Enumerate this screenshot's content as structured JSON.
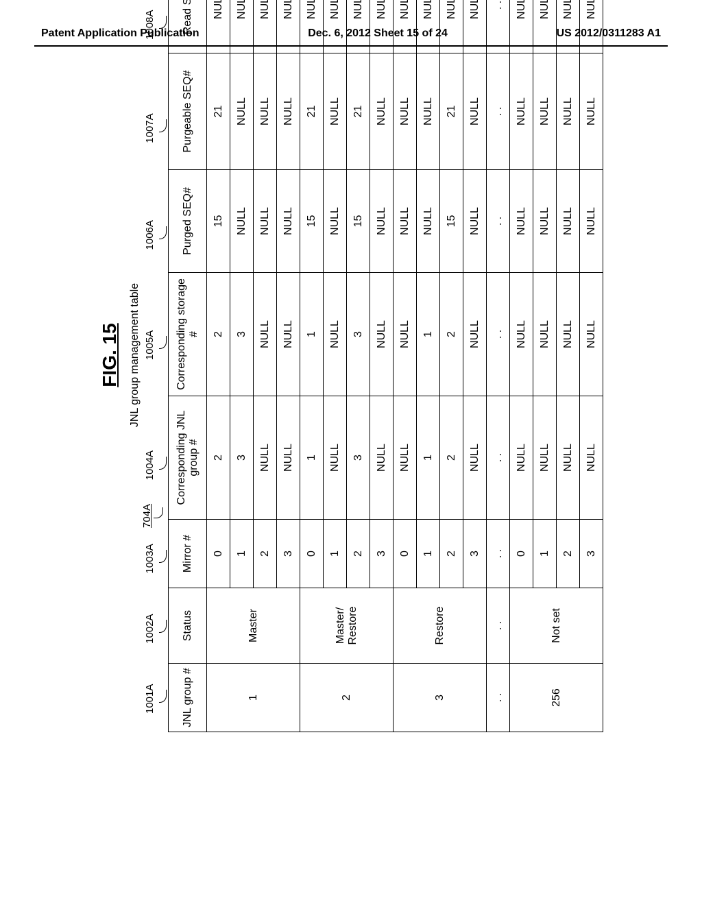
{
  "header": {
    "left": "Patent Application Publication",
    "center": "Dec. 6, 2012  Sheet 15 of 24",
    "right": "US 2012/0311283 A1"
  },
  "figure": {
    "title": "FIG. 15",
    "caption": "JNL group management table",
    "main_ref": "704A",
    "col_refs": [
      "1001A",
      "1002A",
      "1003A",
      "1004A",
      "1005A",
      "1006A",
      "1007A",
      "1008A"
    ],
    "headers": [
      "JNL group #",
      "Status",
      "Mirror #",
      "Corresponding JNL group #",
      "Corresponding storage #",
      "Purged SEQ#",
      "Purgeable SEQ#",
      "Read SEQ#"
    ],
    "groups": [
      {
        "jnl": "1",
        "status": "Master",
        "rows": [
          {
            "mirror": "0",
            "cjnl": "2",
            "cstg": "2",
            "purged": "15",
            "purgeable": "21",
            "read": "NULL"
          },
          {
            "mirror": "1",
            "cjnl": "3",
            "cstg": "3",
            "purged": "NULL",
            "purgeable": "NULL",
            "read": "NULL"
          },
          {
            "mirror": "2",
            "cjnl": "NULL",
            "cstg": "NULL",
            "purged": "NULL",
            "purgeable": "NULL",
            "read": "NULL"
          },
          {
            "mirror": "3",
            "cjnl": "NULL",
            "cstg": "NULL",
            "purged": "NULL",
            "purgeable": "NULL",
            "read": "NULL"
          }
        ]
      },
      {
        "jnl": "2",
        "status": "Master/ Restore",
        "rows": [
          {
            "mirror": "0",
            "cjnl": "1",
            "cstg": "1",
            "purged": "15",
            "purgeable": "21",
            "read": "NULL"
          },
          {
            "mirror": "1",
            "cjnl": "NULL",
            "cstg": "NULL",
            "purged": "NULL",
            "purgeable": "NULL",
            "read": "NULL"
          },
          {
            "mirror": "2",
            "cjnl": "3",
            "cstg": "3",
            "purged": "15",
            "purgeable": "21",
            "read": "NULL"
          },
          {
            "mirror": "3",
            "cjnl": "NULL",
            "cstg": "NULL",
            "purged": "NULL",
            "purgeable": "NULL",
            "read": "NULL"
          }
        ]
      },
      {
        "jnl": "3",
        "status": "Restore",
        "rows": [
          {
            "mirror": "0",
            "cjnl": "NULL",
            "cstg": "NULL",
            "purged": "NULL",
            "purgeable": "NULL",
            "read": "NULL"
          },
          {
            "mirror": "1",
            "cjnl": "1",
            "cstg": "1",
            "purged": "NULL",
            "purgeable": "NULL",
            "read": "NULL"
          },
          {
            "mirror": "2",
            "cjnl": "2",
            "cstg": "2",
            "purged": "15",
            "purgeable": "21",
            "read": "NULL"
          },
          {
            "mirror": "3",
            "cjnl": "NULL",
            "cstg": "NULL",
            "purged": "NULL",
            "purgeable": "NULL",
            "read": "NULL"
          }
        ]
      },
      {
        "jnl": ". .",
        "status": ". .",
        "rows": [
          {
            "mirror": ". .",
            "cjnl": ". .",
            "cstg": ". .",
            "purged": ". .",
            "purgeable": ". .",
            "read": ". ."
          }
        ]
      },
      {
        "jnl": "256",
        "status": "Not set",
        "rows": [
          {
            "mirror": "0",
            "cjnl": "NULL",
            "cstg": "NULL",
            "purged": "NULL",
            "purgeable": "NULL",
            "read": "NULL"
          },
          {
            "mirror": "1",
            "cjnl": "NULL",
            "cstg": "NULL",
            "purged": "NULL",
            "purgeable": "NULL",
            "read": "NULL"
          },
          {
            "mirror": "2",
            "cjnl": "NULL",
            "cstg": "NULL",
            "purged": "NULL",
            "purgeable": "NULL",
            "read": "NULL"
          },
          {
            "mirror": "3",
            "cjnl": "NULL",
            "cstg": "NULL",
            "purged": "NULL",
            "purgeable": "NULL",
            "read": "NULL"
          }
        ]
      }
    ]
  }
}
